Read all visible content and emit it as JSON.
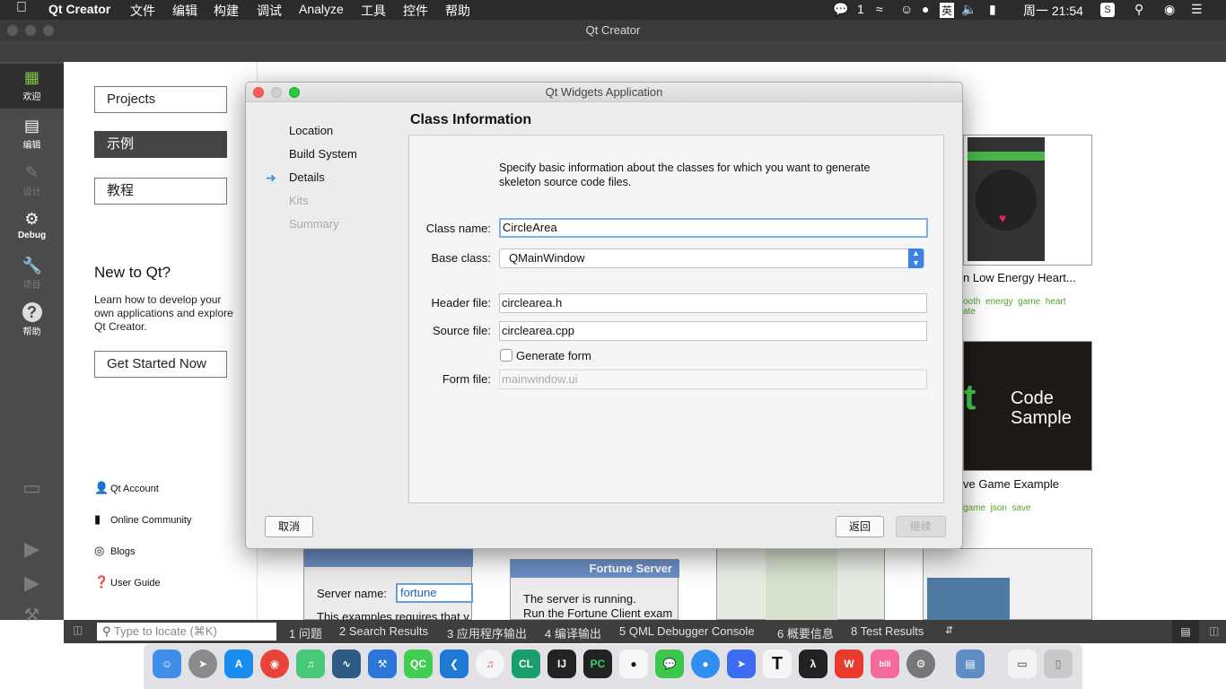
{
  "menubar": {
    "app": "Qt Creator",
    "items": [
      "文件",
      "编辑",
      "构建",
      "调试",
      "Analyze",
      "工具",
      "控件",
      "帮助"
    ],
    "wechat_count": "1",
    "ime": "英",
    "clock": "周一 21:54"
  },
  "window": {
    "title": "Qt Creator"
  },
  "modes": [
    {
      "label": "欢迎",
      "icon": "grid-icon"
    },
    {
      "label": "编辑",
      "icon": "document-icon"
    },
    {
      "label": "设计",
      "icon": "pencil-icon"
    },
    {
      "label": "Debug",
      "icon": "bug-icon"
    },
    {
      "label": "项目",
      "icon": "wrench-icon"
    },
    {
      "label": "帮助",
      "icon": "help-icon"
    }
  ],
  "welcome": {
    "projects": "Projects",
    "examples": "示例",
    "tutorials": "教程",
    "new_heading": "New to Qt?",
    "new_text": "Learn how to develop your own applications and explore Qt Creator.",
    "get_started": "Get Started Now",
    "links": [
      "Qt Account",
      "Online Community",
      "Blogs",
      "User Guide"
    ]
  },
  "examples": {
    "card1_title": "n Low Energy Heart...",
    "card1_tags": [
      "ooth",
      "energy",
      "game",
      "heart",
      "ate"
    ],
    "card2_title": "ve Game Example",
    "card2_tags": [
      "game",
      "json",
      "save"
    ],
    "code_sample_1": "Code",
    "code_sample_2": "Sample",
    "fortune_server": "Fortune Server",
    "server_running": "The server is running.",
    "run_client": "Run the Fortune Client exam",
    "server_name_label": "Server name:",
    "server_name_value": "fortune",
    "requires_text": "This examples requires that y"
  },
  "dialog": {
    "title": "Qt Widgets Application",
    "steps": [
      "Location",
      "Build System",
      "Details",
      "Kits",
      "Summary"
    ],
    "current_step": "Details",
    "heading": "Class Information",
    "intro_1": "Specify basic information about the classes for which you want to generate",
    "intro_2": "skeleton source code files.",
    "class_name_label": "Class name:",
    "class_name_value": "CircleArea",
    "base_class_label": "Base class:",
    "base_class_value": "QMainWindow",
    "header_label": "Header file:",
    "header_value": "circlearea.h",
    "source_label": "Source file:",
    "source_value": "circlearea.cpp",
    "generate_form_label": "Generate form",
    "generate_form_checked": false,
    "form_label": "Form file:",
    "form_placeholder": "mainwindow.ui",
    "cancel": "取消",
    "back": "返回",
    "continue": "继续"
  },
  "outbar": {
    "locator_placeholder": "Type to locate (⌘K)",
    "panes": [
      "1  问题",
      "2  Search Results",
      "3  应用程序输出",
      "4  编译输出",
      "5  QML Debugger Console",
      "6  概要信息",
      "8  Test Results"
    ]
  },
  "dock": [
    "Finder",
    "Launchpad",
    "App Store",
    "Chrome",
    "Music",
    "MySQL Workbench",
    "Xcode",
    "Qt Creator",
    "VS Code",
    "iTunes",
    "CLion",
    "IntelliJ IDEA",
    "PyCharm",
    "QQ",
    "WeChat",
    "Dingtalk",
    "Lark",
    "Typora",
    "Acrobat",
    "WPS",
    "bilibili",
    "System Preferences",
    "Preview",
    "Chrome Window",
    "Trash"
  ],
  "colors": {
    "accent": "#4a90d9",
    "tag_green": "#5aa02c",
    "modebar": "#4b4b4b"
  }
}
